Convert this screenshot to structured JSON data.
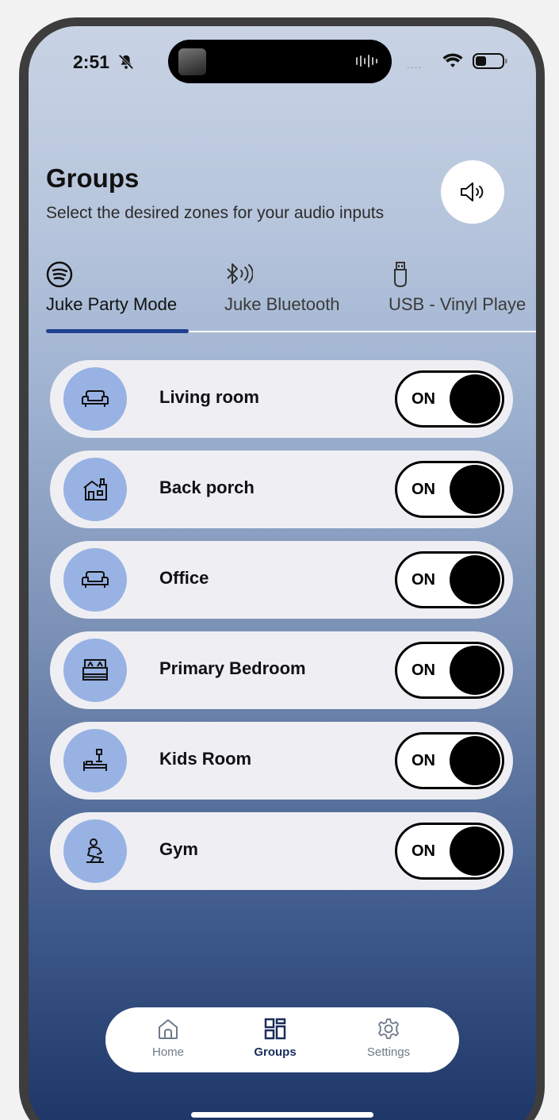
{
  "status_bar": {
    "time": "2:51",
    "icons": [
      "bell-slash-icon",
      "now-playing-thumbnail",
      "audio-wave-icon",
      "signal-dots",
      "wifi-icon",
      "battery-icon"
    ]
  },
  "header": {
    "title": "Groups",
    "subtitle": "Select the desired zones for your audio inputs",
    "volume_icon": "speaker-volume-icon"
  },
  "tabs": [
    {
      "label": "Juke Party Mode",
      "icon": "spotify-icon",
      "active": true
    },
    {
      "label": "Juke Bluetooth",
      "icon": "bluetooth-audio-icon",
      "active": false
    },
    {
      "label": "USB - Vinyl Playe",
      "icon": "usb-icon",
      "active": false
    }
  ],
  "zones": [
    {
      "name": "Living room",
      "icon": "sofa-icon",
      "toggle": "ON"
    },
    {
      "name": "Back porch",
      "icon": "house-porch-icon",
      "toggle": "ON"
    },
    {
      "name": "Office",
      "icon": "sofa-icon",
      "toggle": "ON"
    },
    {
      "name": "Primary Bedroom",
      "icon": "bed-icon",
      "toggle": "ON"
    },
    {
      "name": "Kids Room",
      "icon": "kids-bed-lamp-icon",
      "toggle": "ON"
    },
    {
      "name": "Gym",
      "icon": "exercise-icon",
      "toggle": "ON"
    }
  ],
  "nav": {
    "items": [
      {
        "label": "Home",
        "icon": "home-icon",
        "active": false
      },
      {
        "label": "Groups",
        "icon": "groups-grid-icon",
        "active": true
      },
      {
        "label": "Settings",
        "icon": "settings-gear-icon",
        "active": false
      }
    ]
  },
  "colors": {
    "accent": "#1f3f8f",
    "zone_icon_bg": "#98b2e4",
    "card_bg": "#efeff3"
  }
}
